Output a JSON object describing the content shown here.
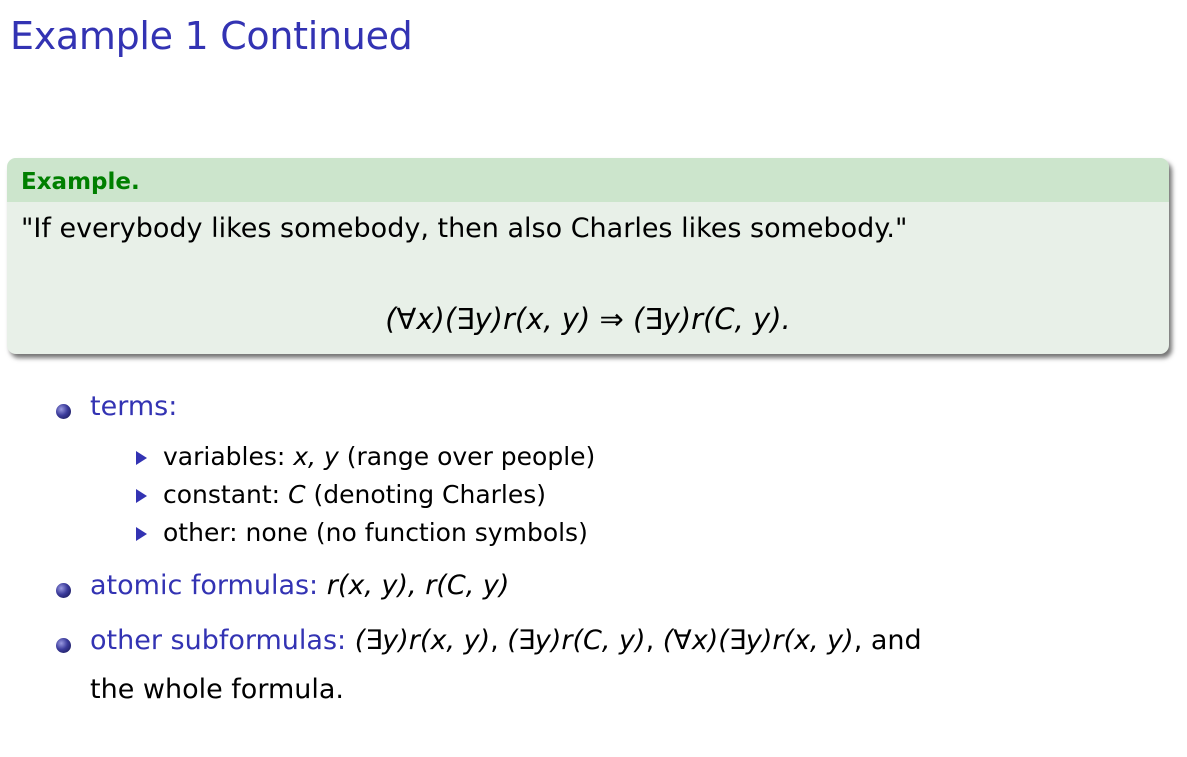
{
  "slide": {
    "title": "Example 1 Continued"
  },
  "block": {
    "header": "Example.",
    "sentence": "\"If everybody likes somebody, then also Charles likes somebody.\"",
    "formula": "(∀x)(∃y)r(x, y) ⇒ (∃y)r(C, y)."
  },
  "bullets": {
    "terms": {
      "label": "terms:",
      "sub": [
        {
          "label": "variables:",
          "math": "x, y",
          "rest": "(range over people)"
        },
        {
          "label": "constant:",
          "math": "C",
          "rest": "(denoting Charles)"
        },
        {
          "label": "other:",
          "math": "",
          "rest": "none (no function symbols)"
        }
      ]
    },
    "atomic": {
      "label": "atomic formulas:",
      "math": "r(x, y), r(C, y)"
    },
    "other": {
      "label": "other subformulas:",
      "math1": "(∃y)r(x, y)",
      "math2": "(∃y)r(C, y)",
      "math3": "(∀x)(∃y)r(x, y)",
      "tail": ", and",
      "continuation": "the whole formula."
    }
  },
  "colors": {
    "structure": "#3333b3",
    "block_title": "#007f00",
    "block_header_bg": "#cce5cc",
    "block_body_bg": "#e8f0e8"
  }
}
